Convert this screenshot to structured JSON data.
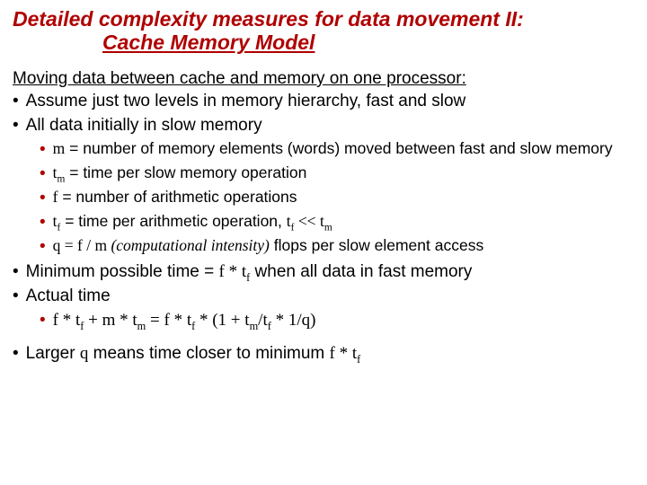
{
  "title": {
    "line1": "Detailed complexity measures for data movement II:",
    "line2": "Cache Memory Model"
  },
  "intro": "Moving data between cache and memory on one processor:",
  "top_bullets": [
    "Assume just two levels in memory hierarchy, fast and slow",
    "All data initially in slow memory"
  ],
  "defs": {
    "m_var": "m",
    "m_txt": " = number of memory elements (words) moved between fast and slow memory",
    "tm_var_pre": "t",
    "tm_var_sub": "m",
    "tm_txt": " = time per slow memory operation",
    "f_var": "f",
    "f_txt": " = number of arithmetic operations",
    "tf_var_pre": "t",
    "tf_var_sub": "f",
    "tf_txt": " = time per arithmetic operation,  ",
    "tf_rel": " << ",
    "q_lhs": "q = f / m  ",
    "q_paren": "(computational intensity)",
    "q_tail": "  flops per slow element access"
  },
  "tail": {
    "min_pre": "Minimum possible time = ",
    "min_expr_pre": "f * t",
    "min_expr_sub": "f",
    "min_post": "  when all data in fast memory",
    "actual": "Actual time",
    "actual_eq_left1": "f * t",
    "actual_eq_left1s": "f",
    "actual_eq_plus": "  +  m * t",
    "actual_eq_left2s": "m",
    "actual_eq_mid": "   =   f * t",
    "actual_eq_right1s": "f",
    "actual_eq_right2": " * (1 + t",
    "actual_eq_right2s": "m",
    "actual_eq_right3": "/t",
    "actual_eq_right3s": "f",
    "actual_eq_right4": "  * 1/q)",
    "larger_pre": "Larger ",
    "larger_q": "q",
    "larger_mid": " means time closer to minimum ",
    "larger_expr": "f * t",
    "larger_expr_s": "f"
  }
}
